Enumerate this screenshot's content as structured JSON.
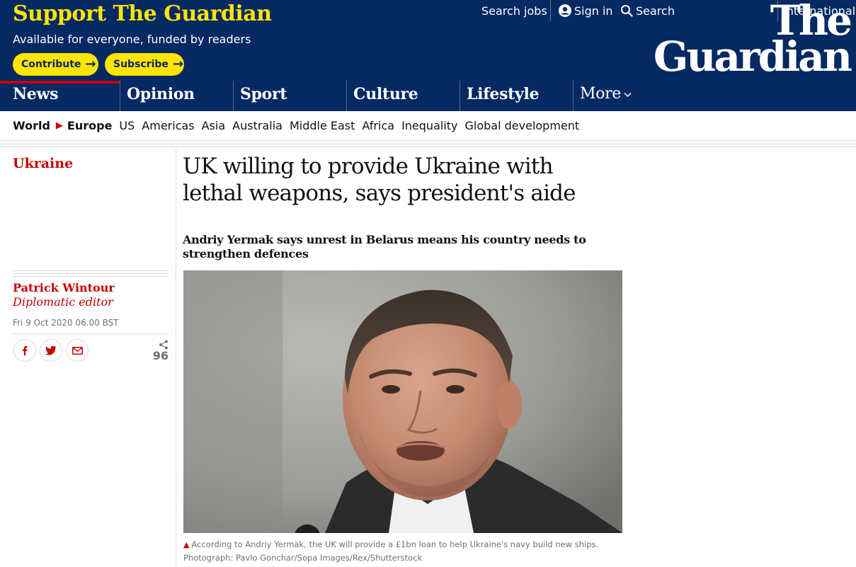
{
  "header": {
    "support_title": "Support The Guardian",
    "support_subtitle": "Available for everyone, funded by readers",
    "contribute_label": "Contribute",
    "subscribe_label": "Subscribe",
    "search_jobs_label": "Search jobs",
    "sign_in_label": "Sign in",
    "search_label": "Search",
    "edition_label": "International",
    "logo_line1": "The",
    "logo_line2": "Guardian"
  },
  "pillars": [
    {
      "label": "News",
      "active": true
    },
    {
      "label": "Opinion"
    },
    {
      "label": "Sport"
    },
    {
      "label": "Culture"
    },
    {
      "label": "Lifestyle"
    },
    {
      "label": "More"
    }
  ],
  "subnav": {
    "world": "World",
    "current": "Europe",
    "items": [
      "US",
      "Americas",
      "Asia",
      "Australia",
      "Middle East",
      "Africa",
      "Inequality",
      "Global development"
    ]
  },
  "article": {
    "section": "Ukraine",
    "headline": "UK willing to provide Ukraine with lethal weapons, says president's aide",
    "standfirst": "Andriy Yermak says unrest in Belarus means his country needs to strengthen defences",
    "author": "Patrick Wintour",
    "author_role": "Diplomatic editor",
    "date": "Fri 9 Oct 2020 06.00 BST",
    "share_count": "96",
    "caption": "According to Andriy Yermak, the UK will provide a £1bn loan to help Ukraine's navy build new ships. Photograph: Pavlo Gonchar/Sopa Images/Rex/Shutterstock"
  },
  "icons": {
    "arrow": "arrow-right-icon",
    "user": "user-icon",
    "search": "search-icon",
    "chevron": "chevron-down-icon",
    "triangle": "triangle-icon",
    "facebook": "facebook-icon",
    "twitter": "twitter-icon",
    "email": "email-icon",
    "share": "share-icon"
  },
  "colors": {
    "brand_blue": "#052962",
    "brand_yellow": "#ffe500",
    "news_red": "#c70000"
  }
}
